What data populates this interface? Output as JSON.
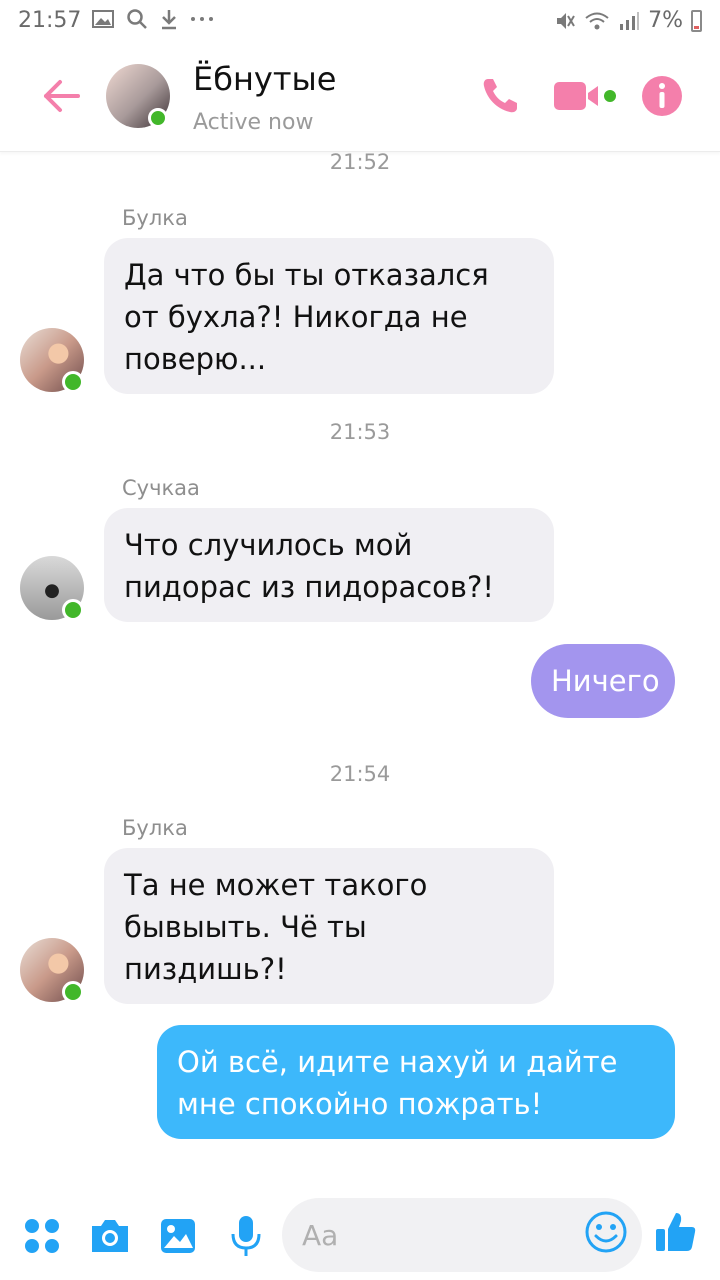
{
  "status_bar": {
    "time": "21:57",
    "battery": "7%"
  },
  "header": {
    "title": "Ёбнутые",
    "status": "Active now"
  },
  "messages": [
    {
      "type": "timestamp",
      "text": "21:52"
    },
    {
      "type": "incoming",
      "sender": "Булка",
      "lines": [
        "Да что бы ты отказался",
        "от бухла?! Никогда не",
        "поверю..."
      ]
    },
    {
      "type": "timestamp",
      "text": "21:53"
    },
    {
      "type": "incoming",
      "sender": "Сучкаа",
      "lines": [
        "Что случилось мой",
        "пидорас из пидорасов?!"
      ]
    },
    {
      "type": "outgoing",
      "text": "Ничего"
    },
    {
      "type": "timestamp",
      "text": "21:54"
    },
    {
      "type": "incoming",
      "sender": "Булка",
      "lines": [
        "Та не может такого",
        "бывыыть. Чё ты",
        "пиздишь?!"
      ]
    },
    {
      "type": "outgoing",
      "lines": [
        "Ой всё, идите нахуй и дайте",
        "мне спокойно пожрать!"
      ]
    }
  ],
  "composer": {
    "placeholder": "Aa"
  },
  "colors": {
    "accent_pink": "#f47fab",
    "outgoing_purple": "#a395ee",
    "outgoing_blue": "#3db8fb",
    "incoming_bg": "#f0eff3",
    "online_green": "#42b72a",
    "toolbar_blue": "#22a3f5"
  },
  "icons": [
    "back-arrow-icon",
    "phone-icon",
    "video-camera-icon",
    "info-icon",
    "apps-icon",
    "camera-icon",
    "gallery-icon",
    "microphone-icon",
    "emoji-icon",
    "thumbs-up-icon"
  ]
}
